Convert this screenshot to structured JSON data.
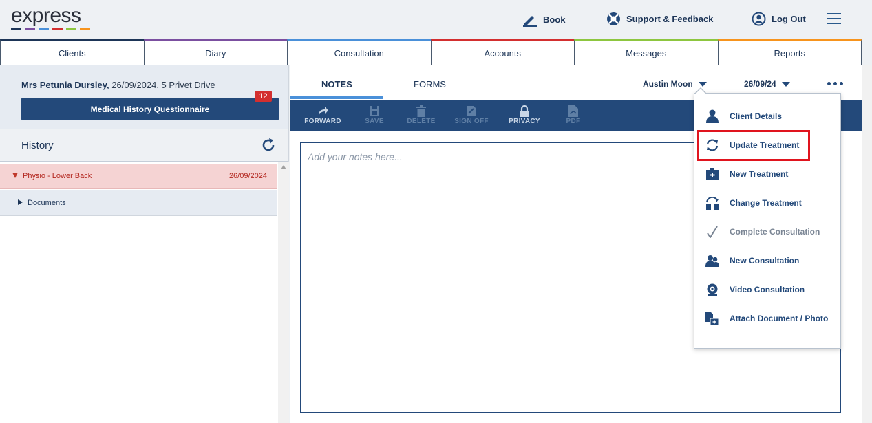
{
  "app": {
    "logo_text": "express",
    "logo_colors": [
      "#1d3557",
      "#7b4fa0",
      "#4a90d9",
      "#d32f2f",
      "#8dc63f",
      "#f7941d"
    ]
  },
  "header": {
    "book_label": "Book",
    "support_label": "Support & Feedback",
    "logout_label": "Log Out"
  },
  "nav": {
    "tabs": [
      {
        "label": "Clients",
        "color": "#1d3557"
      },
      {
        "label": "Diary",
        "color": "#7b4fa0"
      },
      {
        "label": "Consultation",
        "color": "#4a90d9"
      },
      {
        "label": "Accounts",
        "color": "#d32f2f"
      },
      {
        "label": "Messages",
        "color": "#8dc63f"
      },
      {
        "label": "Reports",
        "color": "#f7941d"
      }
    ]
  },
  "client": {
    "name": "Mrs Petunia Dursley,",
    "details": " 26/09/2024, 5 Privet Drive",
    "mhq_label": "Medical History Questionnaire",
    "mhq_badge": "12"
  },
  "history": {
    "title": "History",
    "items": [
      {
        "label": "Physio - Lower Back",
        "date": "26/09/2024"
      },
      {
        "label": "Documents"
      }
    ]
  },
  "main": {
    "tabs": [
      {
        "label": "NOTES",
        "active": true
      },
      {
        "label": "FORMS",
        "active": false
      }
    ],
    "practitioner": "Austin Moon",
    "date": "26/09/24",
    "notes_placeholder": "Add your notes here..."
  },
  "toolbar": {
    "items": [
      {
        "label": "FORWARD",
        "icon": "forward-icon",
        "enabled": true
      },
      {
        "label": "SAVE",
        "icon": "save-icon",
        "enabled": false
      },
      {
        "label": "DELETE",
        "icon": "trash-icon",
        "enabled": false
      },
      {
        "label": "SIGN OFF",
        "icon": "sign-off-icon",
        "enabled": false
      },
      {
        "label": "PRIVACY",
        "icon": "lock-icon",
        "enabled": true
      },
      {
        "label": "PDF",
        "icon": "pdf-icon",
        "enabled": false
      }
    ]
  },
  "menu": {
    "items": [
      {
        "label": "Client Details",
        "icon": "person-icon"
      },
      {
        "label": "Update Treatment",
        "icon": "refresh-icon"
      },
      {
        "label": "New Treatment",
        "icon": "medical-kit-icon"
      },
      {
        "label": "Change Treatment",
        "icon": "swap-icon"
      },
      {
        "label": "Complete Consultation",
        "icon": "checkmark-icon"
      },
      {
        "label": "New Consultation",
        "icon": "people-icon"
      },
      {
        "label": "Video Consultation",
        "icon": "webcam-icon"
      },
      {
        "label": "Attach Document / Photo",
        "icon": "attach-document-icon"
      }
    ],
    "highlighted": "Update Treatment"
  }
}
